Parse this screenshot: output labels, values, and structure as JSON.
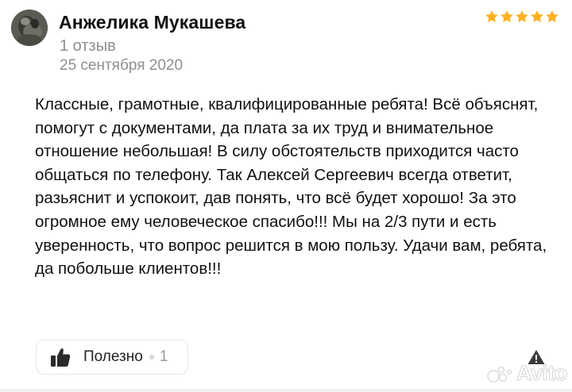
{
  "author": {
    "name": "Анжелика Мукашева",
    "reviews_count": "1 отзыв",
    "date": "25 сентября 2020"
  },
  "rating": {
    "stars": 5,
    "max": 5,
    "color": "#ffb021"
  },
  "review": {
    "text": "Классные, грамотные, квалифицированные ребята! Всё объяснят, помогут с документами, да плата за их труд и внимательное отношение небольшая! В силу обстоятельств приходится часто общаться по телефону. Так Алексей Сергеевич всегда ответит, разьяснит и успокоит, дав понять, что всё будет хорошо! За это огромное ему человеческое спасибо!!! Мы на 2/3 пути и есть уверенность, что вопрос решится в мою пользу. Удачи вам, ребята, да побольше клиентов!!!"
  },
  "actions": {
    "helpful_label": "Полезно",
    "helpful_count": "1",
    "thumb_icon": "thumbs-up-icon",
    "report_icon": "warning-triangle-icon"
  },
  "watermark": {
    "text": "Avito",
    "icon": "avito-logo-icon"
  }
}
